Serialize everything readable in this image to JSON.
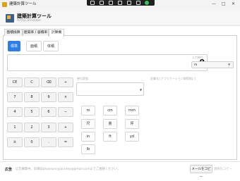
{
  "window": {
    "title": "建築計算ツール",
    "min": "—",
    "max": "□",
    "close": "✕"
  },
  "header": {
    "name": "建築計算ツール",
    "sub": "ArchiCalculator"
  },
  "tabs": [
    {
      "label": "面積換算"
    },
    {
      "label": "建築率 / 容積率"
    },
    {
      "label": "計算機"
    }
  ],
  "modes": [
    "標準",
    "面積",
    "体積"
  ],
  "display": {
    "value": "0"
  },
  "unit": {
    "label": "入力単位",
    "selected": "m"
  },
  "keys": [
    "CE",
    "C",
    "⌫",
    "÷",
    "7",
    "8",
    "9",
    "×",
    "4",
    "5",
    "6",
    "−",
    "1",
    "2",
    "3",
    "+",
    "±",
    "0",
    ".",
    "="
  ],
  "unit_select": {
    "label": "単位変換"
  },
  "info": {
    "label": "計算式 (アプリケーション取得前に)"
  },
  "unit_keys": [
    "m",
    "cm",
    "mm",
    "尺",
    "畳",
    "坪",
    "in",
    "ft",
    "yd",
    "lb"
  ],
  "footer": {
    "ad_label": "広告",
    "ad_text": "広告募集中。詳細はphoosunnyjourney@gmail.comまでご連絡ください。",
    "copy_button": "メールをコピー",
    "copy_note": "連絡先コピー"
  },
  "colors": {
    "accent": "#2f7ee3",
    "icon_bg": "#3f5f88",
    "icon_fg": "#e8b43c"
  }
}
